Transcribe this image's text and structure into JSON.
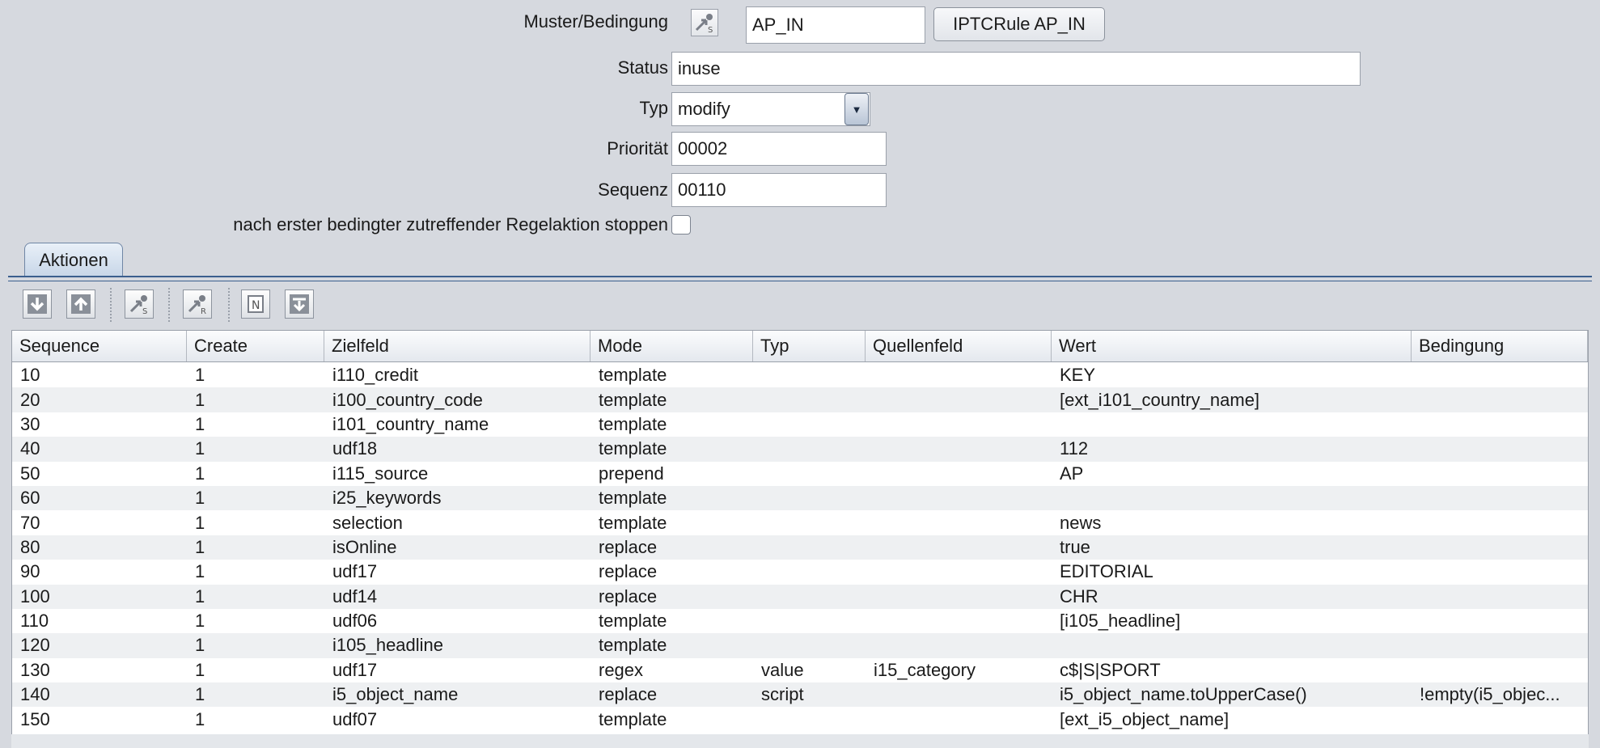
{
  "form": {
    "pattern": {
      "label": "Muster/Bedingung",
      "icon": "script-s-icon",
      "value": "AP_IN",
      "button_label": "IPTCRule AP_IN"
    },
    "status": {
      "label": "Status",
      "value": "inuse"
    },
    "type": {
      "label": "Typ",
      "value": "modify",
      "arrow": "▼"
    },
    "priority": {
      "label": "Priorität",
      "value": "00002"
    },
    "sequence": {
      "label": "Sequenz",
      "value": "00110"
    },
    "stop": {
      "label": "nach erster bedingter zutreffender Regelaktion stoppen",
      "checked": false
    }
  },
  "tabs": [
    {
      "label": "Aktionen",
      "active": true
    }
  ],
  "toolbar": [
    {
      "name": "move-down-icon"
    },
    {
      "name": "move-up-icon"
    },
    {
      "name": "script-s-icon"
    },
    {
      "name": "script-r-icon"
    },
    {
      "name": "new-document-icon"
    },
    {
      "name": "insert-icon"
    }
  ],
  "table": {
    "columns": [
      "Sequence",
      "Create",
      "Zielfeld",
      "Mode",
      "Typ",
      "Quellenfeld",
      "Wert",
      "Bedingung"
    ],
    "rows": [
      [
        "10",
        "1",
        "i110_credit",
        "template",
        "",
        "",
        "KEY",
        ""
      ],
      [
        "20",
        "1",
        "i100_country_code",
        "template",
        "",
        "",
        "[ext_i101_country_name]",
        ""
      ],
      [
        "30",
        "1",
        "i101_country_name",
        "template",
        "",
        "",
        "",
        ""
      ],
      [
        "40",
        "1",
        "udf18",
        "template",
        "",
        "",
        "112",
        ""
      ],
      [
        "50",
        "1",
        "i115_source",
        "prepend",
        "",
        "",
        "AP",
        ""
      ],
      [
        "60",
        "1",
        "i25_keywords",
        "template",
        "",
        "",
        "",
        ""
      ],
      [
        "70",
        "1",
        "selection",
        "template",
        "",
        "",
        "news",
        ""
      ],
      [
        "80",
        "1",
        "isOnline",
        "replace",
        "",
        "",
        "true",
        ""
      ],
      [
        "90",
        "1",
        "udf17",
        "replace",
        "",
        "",
        "EDITORIAL",
        ""
      ],
      [
        "100",
        "1",
        "udf14",
        "replace",
        "",
        "",
        "CHR",
        ""
      ],
      [
        "110",
        "1",
        "udf06",
        "template",
        "",
        "",
        "[i105_headline]",
        ""
      ],
      [
        "120",
        "1",
        "i105_headline",
        "template",
        "",
        "",
        "",
        ""
      ],
      [
        "130",
        "1",
        "udf17",
        "regex",
        "value",
        "i15_category",
        "c$|S|SPORT",
        ""
      ],
      [
        "140",
        "1",
        "i5_object_name",
        "replace",
        "script",
        "",
        "i5_object_name.toUpperCase()",
        "!empty(i5_objec..."
      ],
      [
        "150",
        "1",
        "udf07",
        "template",
        "",
        "",
        "[ext_i5_object_name]",
        ""
      ]
    ]
  }
}
